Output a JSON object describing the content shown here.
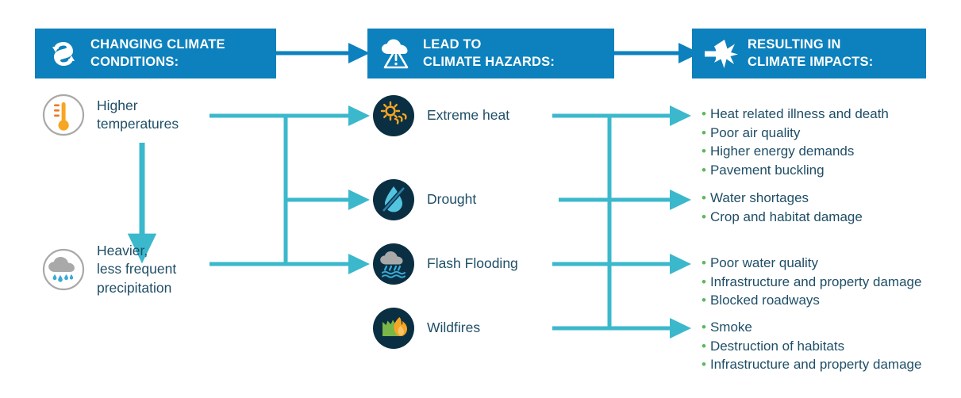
{
  "colors": {
    "banner_blue": "#0c81bd",
    "connector_teal": "#3bb8cc",
    "text_navy": "#1f4e66",
    "bullet_green": "#5cb85c",
    "icon_dark_circle": "#0b2f42",
    "icon_gray": "#9a9a9a",
    "icon_orange": "#f5a623",
    "icon_light_blue": "#52c4e0",
    "icon_green": "#7ab648"
  },
  "headers": [
    {
      "id": "changing-climate-conditions",
      "icon": "cycle-arrows-icon",
      "title": "CHANGING CLIMATE\nCONDITIONS:"
    },
    {
      "id": "lead-to-climate-hazards",
      "icon": "cloud-warning-icon",
      "title": "LEAD TO\nCLIMATE HAZARDS:"
    },
    {
      "id": "resulting-in-climate-impacts",
      "icon": "arrow-starburst-icon",
      "title": "RESULTING IN\nCLIMATE IMPACTS:"
    }
  ],
  "conditions": [
    {
      "id": "higher-temperatures",
      "icon": "thermometer-icon",
      "label": "Higher\ntemperatures"
    },
    {
      "id": "heavier-less-frequent-precipitation",
      "icon": "rain-cloud-icon",
      "label": "Heavier,\nless frequent\nprecipitation"
    }
  ],
  "hazards": [
    {
      "id": "extreme-heat",
      "icon": "sun-heat-icon",
      "label": "Extreme heat"
    },
    {
      "id": "drought",
      "icon": "no-water-drop-icon",
      "label": "Drought"
    },
    {
      "id": "flash-flooding",
      "icon": "storm-flood-icon",
      "label": "Flash Flooding"
    },
    {
      "id": "wildfires",
      "icon": "wildfire-icon",
      "label": "Wildfires"
    }
  ],
  "impacts": [
    {
      "id": "extreme-heat-impacts",
      "items": [
        "Heat related illness and death",
        "Poor air quality",
        "Higher energy demands",
        "Pavement buckling"
      ]
    },
    {
      "id": "drought-impacts",
      "items": [
        "Water shortages",
        "Crop and habitat damage"
      ]
    },
    {
      "id": "flash-flooding-impacts",
      "items": [
        "Poor water quality",
        "Infrastructure and property damage",
        "Blocked roadways"
      ]
    },
    {
      "id": "wildfires-impacts",
      "items": [
        "Smoke",
        "Destruction of habitats",
        "Infrastructure and property damage"
      ]
    }
  ],
  "bullet_glyph": "•"
}
